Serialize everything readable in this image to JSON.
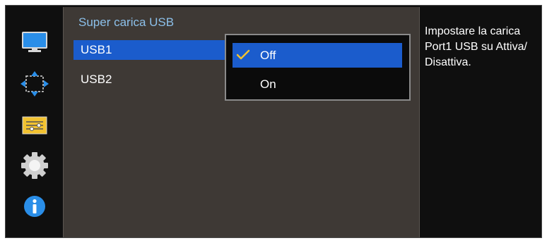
{
  "sidebar": {
    "items": [
      {
        "icon": "monitor-icon",
        "name": "picture"
      },
      {
        "icon": "move-arrows-icon",
        "name": "onscreen-display"
      },
      {
        "icon": "settings-sliders-icon",
        "name": "system"
      },
      {
        "icon": "gear-icon",
        "name": "support"
      },
      {
        "icon": "info-icon",
        "name": "information"
      }
    ]
  },
  "main": {
    "title": "Super carica USB",
    "items": [
      {
        "label": "USB1",
        "selected": true
      },
      {
        "label": "USB2",
        "selected": false
      }
    ]
  },
  "dropdown": {
    "options": [
      {
        "label": "Off",
        "selected": true
      },
      {
        "label": "On",
        "selected": false
      }
    ]
  },
  "help": {
    "text": "Impostare la carica Port1 USB su Attiva/ Disattiva."
  },
  "colors": {
    "accent": "#1b5ccc",
    "title": "#8cc0ea",
    "check": "#f2c230"
  }
}
